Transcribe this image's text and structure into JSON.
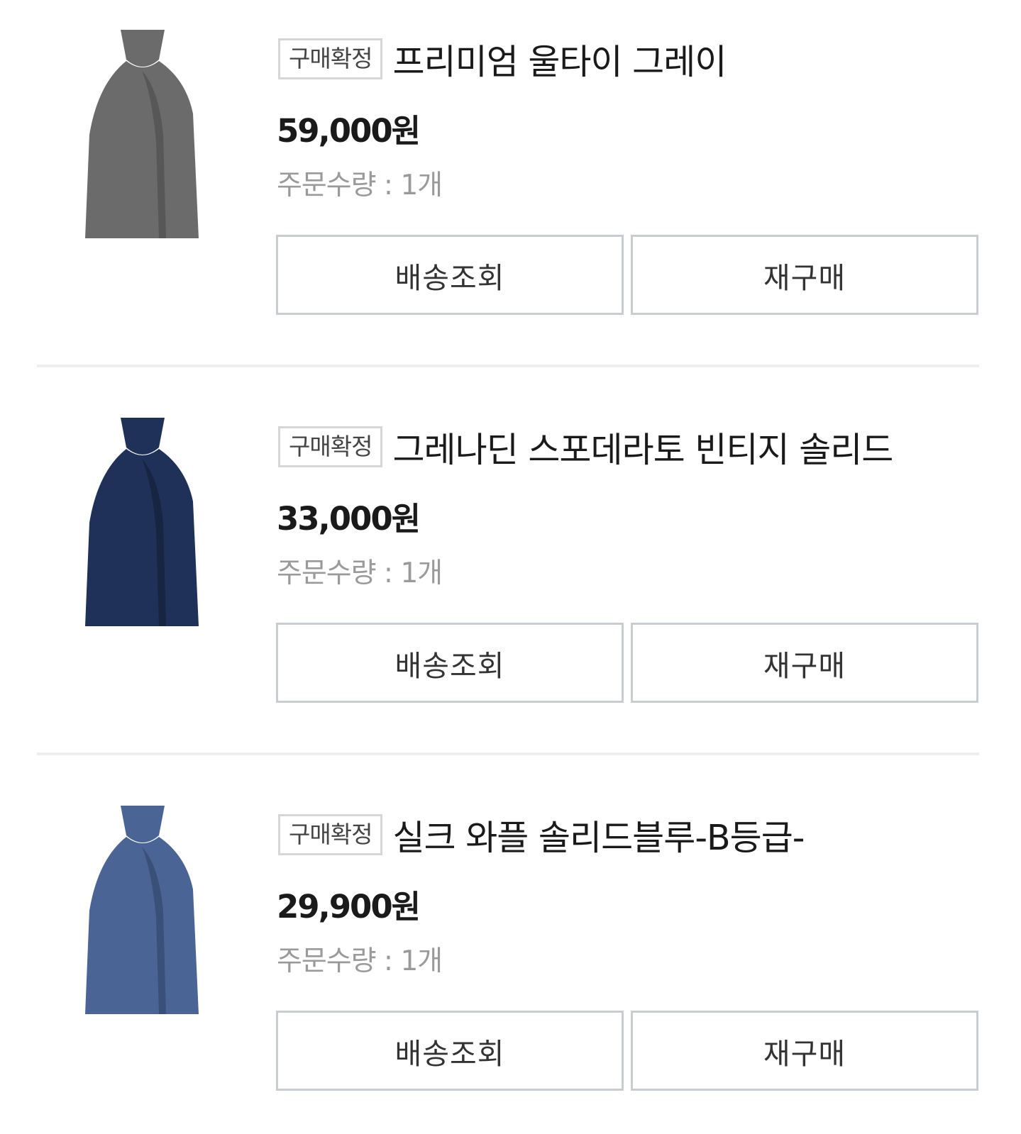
{
  "items": [
    {
      "badge": "구매확정",
      "name": "프리미엄 울타이 그레이",
      "price": "59,000원",
      "qty": "주문수량 : 1개",
      "ship_label": "배송조회",
      "rebuy_label": "재구매",
      "tie_color": "#6b6b6b"
    },
    {
      "badge": "구매확정",
      "name": "그레나딘 스포데라토 빈티지 솔리드",
      "price": "33,000원",
      "qty": "주문수량 : 1개",
      "ship_label": "배송조회",
      "rebuy_label": "재구매",
      "tie_color": "#1f3158"
    },
    {
      "badge": "구매확정",
      "name": "실크 와플 솔리드블루-B등급-",
      "price": "29,900원",
      "qty": "주문수량 : 1개",
      "ship_label": "배송조회",
      "rebuy_label": "재구매",
      "tie_color": "#4a6496"
    }
  ]
}
